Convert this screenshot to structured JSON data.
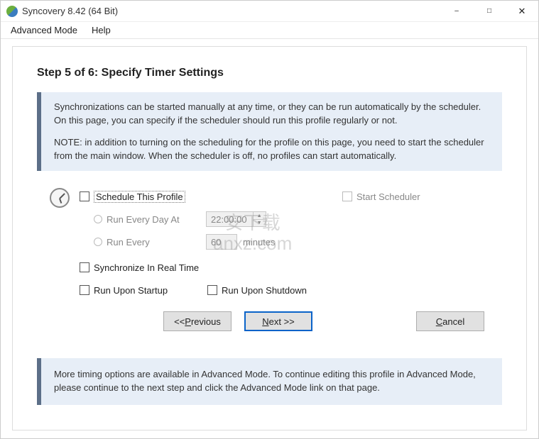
{
  "window": {
    "title": "Syncovery 8.42 (64 Bit)"
  },
  "menu": {
    "advanced": "Advanced Mode",
    "help": "Help"
  },
  "step": {
    "title": "Step 5 of 6: Specify Timer Settings"
  },
  "info": {
    "p1": "Synchronizations can be started manually at any time, or they can be run automatically by the scheduler. On this page, you can specify if the scheduler should run this profile regularly or not.",
    "p2": "NOTE: in addition to turning on the scheduling for the profile on this page, you need to start the scheduler from the main window. When the scheduler is off, no profiles can start automatically."
  },
  "options": {
    "schedule": "Schedule This Profile",
    "runEveryDayAt": "Run Every Day At",
    "timeValue": "22:00:00",
    "runEvery": "Run Every",
    "intervalValue": "60",
    "intervalUnit": "minutes",
    "startScheduler": "Start Scheduler",
    "syncRealTime": "Synchronize In Real Time",
    "runStartup": "Run Upon Startup",
    "runShutdown": "Run Upon Shutdown"
  },
  "buttons": {
    "prev": "<<  Previous",
    "prevU": "P",
    "prevRest": "revious",
    "prevPrefix": "<<  ",
    "next": "Next >>",
    "nextU": "N",
    "nextRest": "ext >>",
    "cancel": "Cancel",
    "cancelU": "C",
    "cancelRest": "ancel"
  },
  "footer": {
    "text": "More timing options are available in Advanced Mode. To continue editing this profile in Advanced Mode, please continue to the next step and click the Advanced Mode link on that page."
  },
  "watermark": {
    "line1": "安下载",
    "line2": "anxz.com"
  }
}
